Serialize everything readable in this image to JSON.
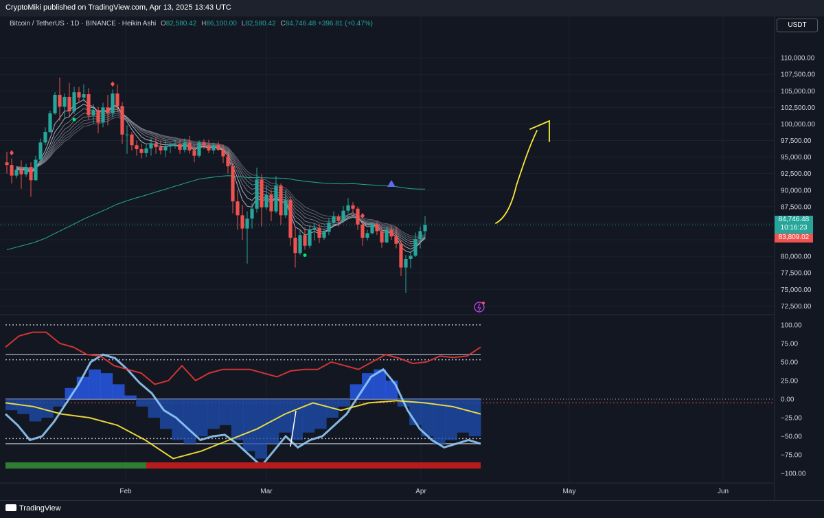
{
  "header": {
    "published": "CryptoMiki published on TradingView.com, Apr 13, 2025 13:43 UTC",
    "symbol": "Bitcoin / TetherUS · 1D · BINANCE · Heikin Ashi",
    "o_label": "O",
    "o_value": "82,580.42",
    "h_label": "H",
    "h_value": "86,100.00",
    "l_label": "L",
    "l_value": "82,580.42",
    "c_label": "C",
    "c_value": "84,746.48",
    "change": "+396.81 (+0.47%)",
    "currency": "USDT"
  },
  "price_labels": {
    "last": "84,746.48",
    "countdown": "10:16:23",
    "prev": "83,809.02"
  },
  "footer": {
    "brand": "TradingView"
  },
  "colors": {
    "up": "#26a69a",
    "down": "#ef5350",
    "grid": "#1e222d",
    "annotation": "#fbe739"
  },
  "chart_data": [
    {
      "type": "candlestick",
      "style": "Heikin Ashi",
      "x_ticks": [
        "Feb",
        "Mar",
        "Apr",
        "May",
        "Jun"
      ],
      "y_ticks": [
        110000,
        107500,
        105000,
        102500,
        100000,
        97500,
        95000,
        92500,
        90000,
        87500,
        85000,
        82500,
        80000,
        77500,
        75000,
        72500
      ],
      "y_tick_labels": [
        "110,000.00",
        "107,500.00",
        "105,000.00",
        "102,500.00",
        "100,000.00",
        "97,500.00",
        "95,000.00",
        "92,500.00",
        "90,000.00",
        "87,500.00",
        "",
        "",
        "80,000.00",
        "77,500.00",
        "75,000.00",
        "72,500.00"
      ],
      "ylim": [
        71500,
        112500
      ],
      "candles": [
        [
          94200,
          95800,
          92500,
          93800
        ],
        [
          93800,
          94800,
          91000,
          92200
        ],
        [
          92200,
          93600,
          91800,
          93100
        ],
        [
          93100,
          94500,
          90200,
          92400
        ],
        [
          92400,
          94000,
          92000,
          93500
        ],
        [
          93500,
          94200,
          89000,
          91500
        ],
        [
          91500,
          95200,
          91400,
          94600
        ],
        [
          94600,
          97800,
          94400,
          97200
        ],
        [
          97200,
          99500,
          96800,
          98800
        ],
        [
          98800,
          102000,
          98600,
          101600
        ],
        [
          101600,
          104800,
          101400,
          104400
        ],
        [
          104400,
          107000,
          100500,
          102600
        ],
        [
          102600,
          104600,
          100800,
          104100
        ],
        [
          104100,
          106200,
          101000,
          101900
        ],
        [
          101900,
          105600,
          101500,
          104800
        ],
        [
          104800,
          105600,
          103200,
          104000
        ],
        [
          104000,
          106000,
          103400,
          104500
        ],
        [
          104500,
          105400,
          100600,
          101300
        ],
        [
          101300,
          103000,
          100000,
          102100
        ],
        [
          102100,
          102600,
          98600,
          100200
        ],
        [
          100200,
          103200,
          99500,
          102500
        ],
        [
          102500,
          104400,
          99800,
          101600
        ],
        [
          101600,
          105200,
          101000,
          104600
        ],
        [
          104600,
          106000,
          101800,
          102700
        ],
        [
          102700,
          103300,
          97000,
          98400
        ],
        [
          98400,
          99800,
          95500,
          98400
        ],
        [
          98400,
          98800,
          96000,
          96800
        ],
        [
          96800,
          97500,
          95200,
          96200
        ],
        [
          96200,
          97000,
          94800,
          95600
        ],
        [
          95600,
          97000,
          95000,
          96300
        ],
        [
          96300,
          98000,
          95200,
          97100
        ],
        [
          97100,
          98100,
          95500,
          96500
        ],
        [
          96500,
          97500,
          95400,
          96000
        ],
        [
          96000,
          97500,
          95000,
          96600
        ],
        [
          96600,
          97200,
          95600,
          96900
        ],
        [
          96900,
          97600,
          96300,
          96900
        ],
        [
          96900,
          97600,
          95500,
          96100
        ],
        [
          96100,
          97800,
          95700,
          97200
        ],
        [
          97200,
          98200,
          95500,
          96000
        ],
        [
          96000,
          96800,
          94200,
          95200
        ],
        [
          95200,
          97500,
          94900,
          97200
        ],
        [
          97200,
          97700,
          96200,
          96800
        ],
        [
          96800,
          97600,
          95600,
          96000
        ],
        [
          96000,
          97200,
          95500,
          96800
        ],
        [
          96800,
          97300,
          95900,
          96100
        ],
        [
          96100,
          96900,
          94100,
          95100
        ],
        [
          95100,
          95900,
          92500,
          93600
        ],
        [
          93600,
          94200,
          86500,
          88300
        ],
        [
          88300,
          90000,
          84000,
          86200
        ],
        [
          86200,
          87800,
          82500,
          84200
        ],
        [
          84200,
          86800,
          78900,
          85700
        ],
        [
          85700,
          88000,
          84200,
          87200
        ],
        [
          87200,
          93400,
          86600,
          91600
        ],
        [
          91600,
          92400,
          84500,
          87400
        ],
        [
          87400,
          90800,
          87000,
          89300
        ],
        [
          89300,
          90000,
          85300,
          86800
        ],
        [
          86800,
          92100,
          86500,
          90700
        ],
        [
          90700,
          91000,
          84800,
          86200
        ],
        [
          86200,
          90000,
          85800,
          88500
        ],
        [
          88500,
          89000,
          81600,
          82800
        ],
        [
          82800,
          84500,
          78300,
          80500
        ],
        [
          80500,
          84000,
          80200,
          83200
        ],
        [
          83200,
          84400,
          81000,
          81600
        ],
        [
          81600,
          84700,
          81200,
          84000
        ],
        [
          84000,
          85000,
          82400,
          84300
        ],
        [
          84300,
          84900,
          82000,
          82800
        ],
        [
          82800,
          84200,
          82500,
          83700
        ],
        [
          83700,
          85800,
          83200,
          85100
        ],
        [
          85100,
          86800,
          84500,
          86000
        ],
        [
          86000,
          86400,
          84500,
          85400
        ],
        [
          85400,
          87600,
          85100,
          86900
        ],
        [
          86900,
          88800,
          86500,
          87700
        ],
        [
          87700,
          88200,
          86500,
          87200
        ],
        [
          87200,
          87500,
          84000,
          84800
        ],
        [
          84800,
          85300,
          81600,
          82800
        ],
        [
          82800,
          84000,
          82400,
          83500
        ],
        [
          83500,
          85200,
          83300,
          84900
        ],
        [
          84900,
          85300,
          83200,
          83800
        ],
        [
          83800,
          84300,
          81300,
          82100
        ],
        [
          82100,
          84400,
          82000,
          84000
        ],
        [
          84000,
          84700,
          82500,
          83000
        ],
        [
          83000,
          84400,
          81200,
          81900
        ],
        [
          81900,
          82400,
          77000,
          78300
        ],
        [
          78300,
          80200,
          74500,
          79600
        ],
        [
          79600,
          80800,
          78200,
          80100
        ],
        [
          80100,
          83600,
          79900,
          82600
        ],
        [
          82600,
          84500,
          81200,
          83800
        ],
        [
          83800,
          86100,
          82580,
          84746
        ]
      ]
    },
    {
      "type": "line",
      "ylim": [
        -110,
        110
      ],
      "y_ticks": [
        100,
        75,
        50,
        25,
        0,
        -25,
        -50,
        -75,
        -100
      ],
      "y_tick_labels": [
        "100.00",
        "75.00",
        "50.00",
        "25.00",
        "0.00",
        "−25.00",
        "−50.00",
        "−75.00",
        "−100.00"
      ],
      "levels": [
        100,
        60,
        53,
        0,
        -53,
        -60
      ],
      "series": [
        {
          "values": [
            -20,
            -35,
            -55,
            -50,
            -30,
            -5,
            20,
            50,
            60,
            55,
            40,
            22,
            8,
            -15,
            -25,
            -40,
            -55,
            -50,
            -48,
            -60,
            -75,
            -90,
            -70,
            -50,
            -65,
            -55,
            -50,
            -35,
            -20,
            5,
            30,
            40,
            20,
            -15,
            -40,
            -55,
            -65,
            -60,
            -55,
            -60
          ]
        },
        {
          "values": [
            70,
            85,
            90,
            90,
            75,
            70,
            60,
            58,
            45,
            40,
            35,
            20,
            25,
            45,
            25,
            35,
            40,
            40,
            40,
            35,
            30,
            38,
            40,
            40,
            50,
            45,
            40,
            50,
            60,
            55,
            48,
            50,
            58,
            56,
            58,
            70
          ]
        },
        {
          "values": [
            -5,
            -10,
            -20,
            -25,
            -35,
            -55,
            -80,
            -70,
            -55,
            -40,
            -20,
            -5,
            -15,
            -5,
            -2,
            -5,
            -10,
            -20
          ]
        }
      ],
      "bar_values": [
        -15,
        -20,
        -30,
        -25,
        -10,
        15,
        30,
        40,
        35,
        20,
        5,
        -10,
        -25,
        -40,
        -55,
        -60,
        -50,
        -40,
        -35,
        -55,
        -70,
        -80,
        -60,
        -45,
        -55,
        -45,
        -40,
        -25,
        -10,
        20,
        35,
        40,
        25,
        -10,
        -35,
        -50,
        -60,
        -55,
        -45,
        -50
      ]
    }
  ]
}
